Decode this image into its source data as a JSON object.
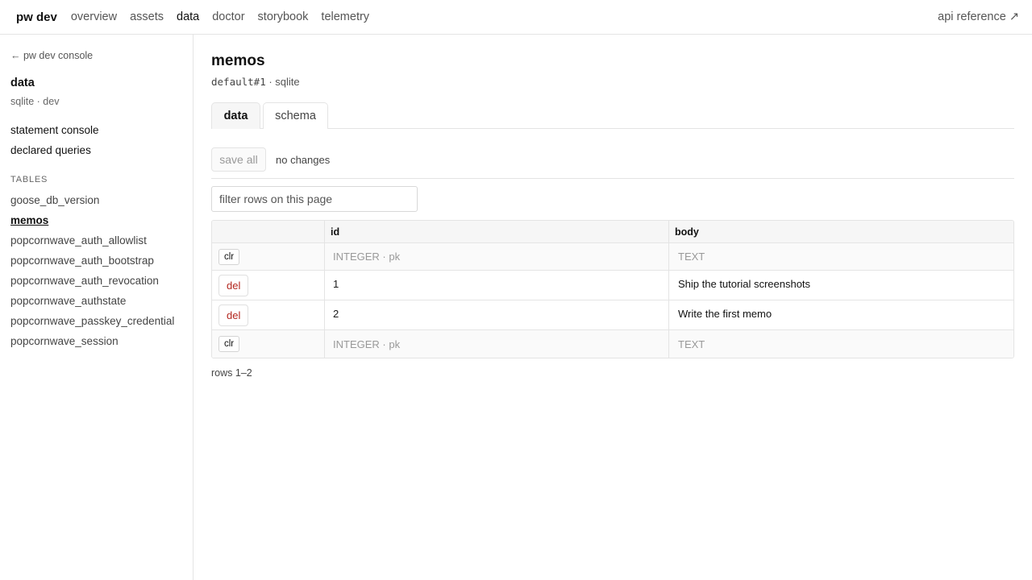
{
  "nav": {
    "brand": "pw dev",
    "links": [
      "overview",
      "assets",
      "data",
      "doctor",
      "storybook",
      "telemetry"
    ],
    "active": "data",
    "api_reference": "api reference ↗"
  },
  "sidebar": {
    "back": "← pw dev console",
    "title": "data",
    "subtitle": "sqlite · dev",
    "links": [
      "statement console",
      "declared queries"
    ],
    "section_label": "TABLES",
    "tables": [
      "goose_db_version",
      "memos",
      "popcornwave_auth_allowlist",
      "popcornwave_auth_bootstrap",
      "popcornwave_auth_revocation",
      "popcornwave_authstate",
      "popcornwave_passkey_credential",
      "popcornwave_session"
    ],
    "active_table": "memos"
  },
  "main": {
    "title": "memos",
    "connection": "default#1",
    "engine": " · sqlite",
    "tabs": [
      "data",
      "schema"
    ],
    "active_tab": "data",
    "save_all": "save all",
    "change_status": "no changes",
    "filter_placeholder": "filter rows on this page",
    "columns": [
      "",
      "id",
      "body"
    ],
    "template_row": {
      "action": "clr",
      "id_hint": "INTEGER · pk",
      "body_hint": "TEXT"
    },
    "rows": [
      {
        "action": "del",
        "id": "1",
        "body": "Ship the tutorial screenshots"
      },
      {
        "action": "del",
        "id": "2",
        "body": "Write the first memo"
      }
    ],
    "rows_info": "rows 1–2"
  }
}
